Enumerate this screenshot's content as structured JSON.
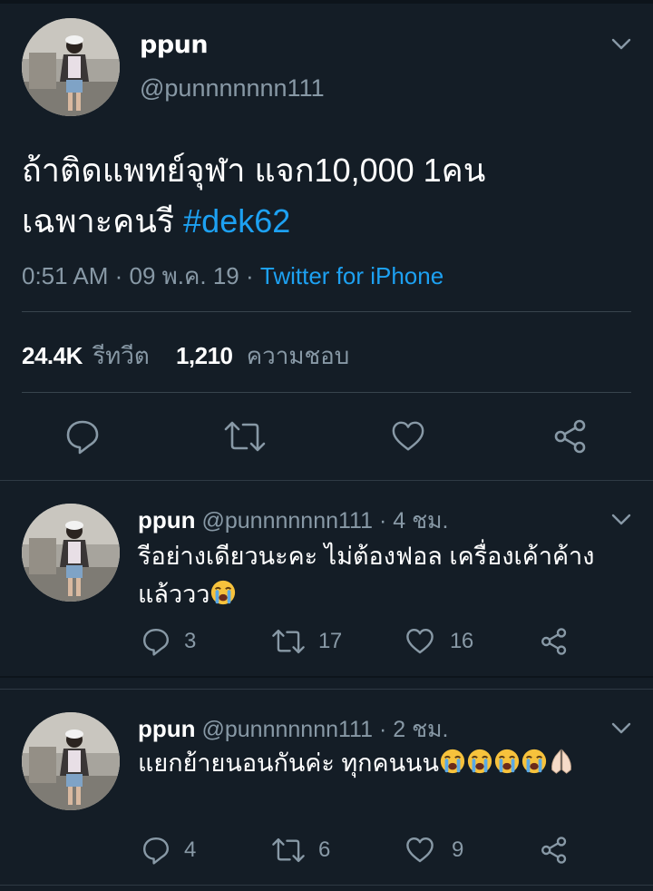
{
  "main_tweet": {
    "display_name": "ppun",
    "handle": "@punnnnnnn111",
    "text_line1": "ถ้าติดแพทย์จุฬา แจก10,000 1คน",
    "text_line2": "เฉพาะคนรี",
    "hashtag": "#dek62",
    "time": "0:51 AM · 09 พ.ค. 19 · ",
    "source": "Twitter for iPhone",
    "retweet_count": "24.4K",
    "retweet_label": "รีทวีต",
    "like_count": "1,210",
    "like_label": "ความชอบ"
  },
  "replies": [
    {
      "display_name": "ppun",
      "handle": "@punnnnnnn111",
      "time": " · 4 ชม.",
      "text_line1": "รีอย่างเดียวนะคะ ไม่ต้องฟอล เครื่องเค้าค้าง",
      "text_line2": "แล้ววว",
      "reply_count": "3",
      "retweet_count": "17",
      "like_count": "16"
    },
    {
      "display_name": "ppun",
      "handle": "@punnnnnnn111",
      "time": " · 2 ชม.",
      "text_line1": "แยกย้ายนอนกันค่ะ ทุกคนนน",
      "reply_count": "4",
      "retweet_count": "6",
      "like_count": "9"
    }
  ],
  "icons": {
    "reply": "speech-bubble-icon",
    "retweet": "retweet-arrows-icon",
    "like": "heart-outline-icon",
    "share": "share-nodes-icon",
    "menu": "chevron-down-icon",
    "emoji_crying": "loudly-crying-face-icon",
    "emoji_pray": "folded-hands-icon"
  },
  "colors": {
    "background": "#141d26",
    "accent": "#1da1f2",
    "muted": "#8899a6",
    "divider": "#38444d"
  }
}
